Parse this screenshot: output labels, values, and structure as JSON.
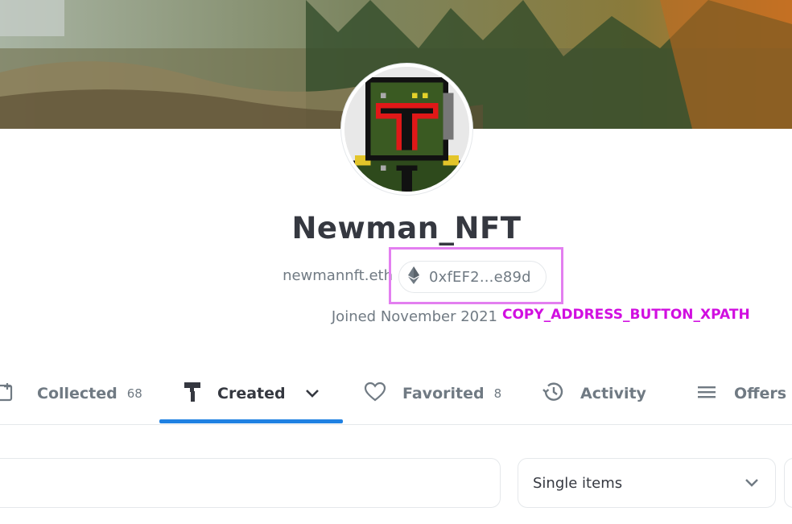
{
  "profile": {
    "username": "Newman_NFT",
    "ens_name": "newmannft.eth",
    "address_short": "0xfEF2...e89d",
    "joined": "Joined November 2021"
  },
  "annotation": {
    "label": "COPY_ADDRESS_BUTTON_XPATH",
    "color": "#d10fe0"
  },
  "tabs": [
    {
      "label": "Collected",
      "count": "68",
      "icon": "collected-icon"
    },
    {
      "label": "Created",
      "count": "",
      "icon": "paint-roller-icon",
      "active": true
    },
    {
      "label": "Favorited",
      "count": "8",
      "icon": "heart-icon"
    },
    {
      "label": "Activity",
      "count": "",
      "icon": "history-icon"
    },
    {
      "label": "Offers",
      "count": "",
      "icon": "list-icon"
    }
  ],
  "filters": {
    "search_placeholder": "",
    "item_type": "Single items"
  },
  "colors": {
    "accent": "#2081e2",
    "text": "#353840",
    "muted": "#707a83",
    "highlight": "#e37ff0"
  }
}
